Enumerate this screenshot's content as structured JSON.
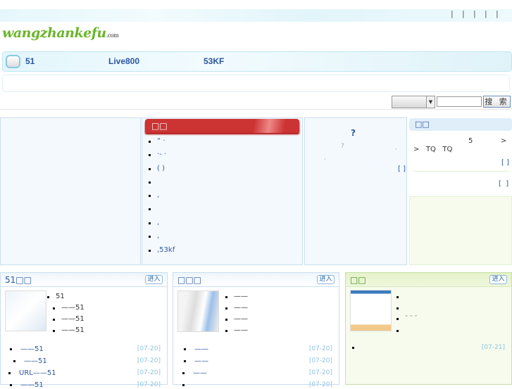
{
  "top": {
    "separators": [
      "|",
      "|",
      "|",
      "|",
      "|"
    ]
  },
  "logo": {
    "text": "wangzhankefu",
    "suffix": ".com"
  },
  "nav": {
    "links": [
      "51",
      "Live800",
      "53KF"
    ]
  },
  "search": {
    "select_value": "",
    "input_value": "",
    "button": "搜 索"
  },
  "news": {
    "title": "□□",
    "items": [
      "“ ·",
      "·- ·",
      "( )",
      "",
      ",",
      "",
      ",",
      ",",
      ",53kf"
    ]
  },
  "faq": {
    "title": "?",
    "q": "?",
    "comma": ",",
    "dot": ",",
    "more": "[ ]"
  },
  "notice": {
    "title": "□□",
    "line1_num": "5",
    "line1_arrow": ">",
    "line2": ">   TQ   TQ",
    "more1": "[ ]",
    "more2": "[  ]"
  },
  "bottom": [
    {
      "title": "51□□",
      "enter": "进入",
      "side_items": [
        "51",
        "——51",
        "——51",
        "——51"
      ],
      "items": [
        {
          "text": "——51",
          "date": "[07-20]"
        },
        {
          "text": "——51",
          "date": "[07-20]"
        },
        {
          "text": "URL——51",
          "date": "[07-20]"
        },
        {
          "text": "——51",
          "date": "[07-20]"
        }
      ]
    },
    {
      "title": "□□□",
      "enter": "进入",
      "side_items": [
        "——",
        "——",
        "——",
        "——"
      ],
      "items": [
        {
          "text": "——",
          "date": "[07-20]"
        },
        {
          "text": "——",
          "date": "[07-20]"
        },
        {
          "text": "——",
          "date": "[07-20]"
        },
        {
          "text": "",
          "date": "[07-20]"
        }
      ]
    },
    {
      "title": "□□",
      "enter": "进入",
      "side_items": [
        "",
        "",
        "“ ” ”",
        "",
        ""
      ],
      "items": [
        {
          "text": "",
          "date": "[07-21]"
        }
      ]
    }
  ]
}
